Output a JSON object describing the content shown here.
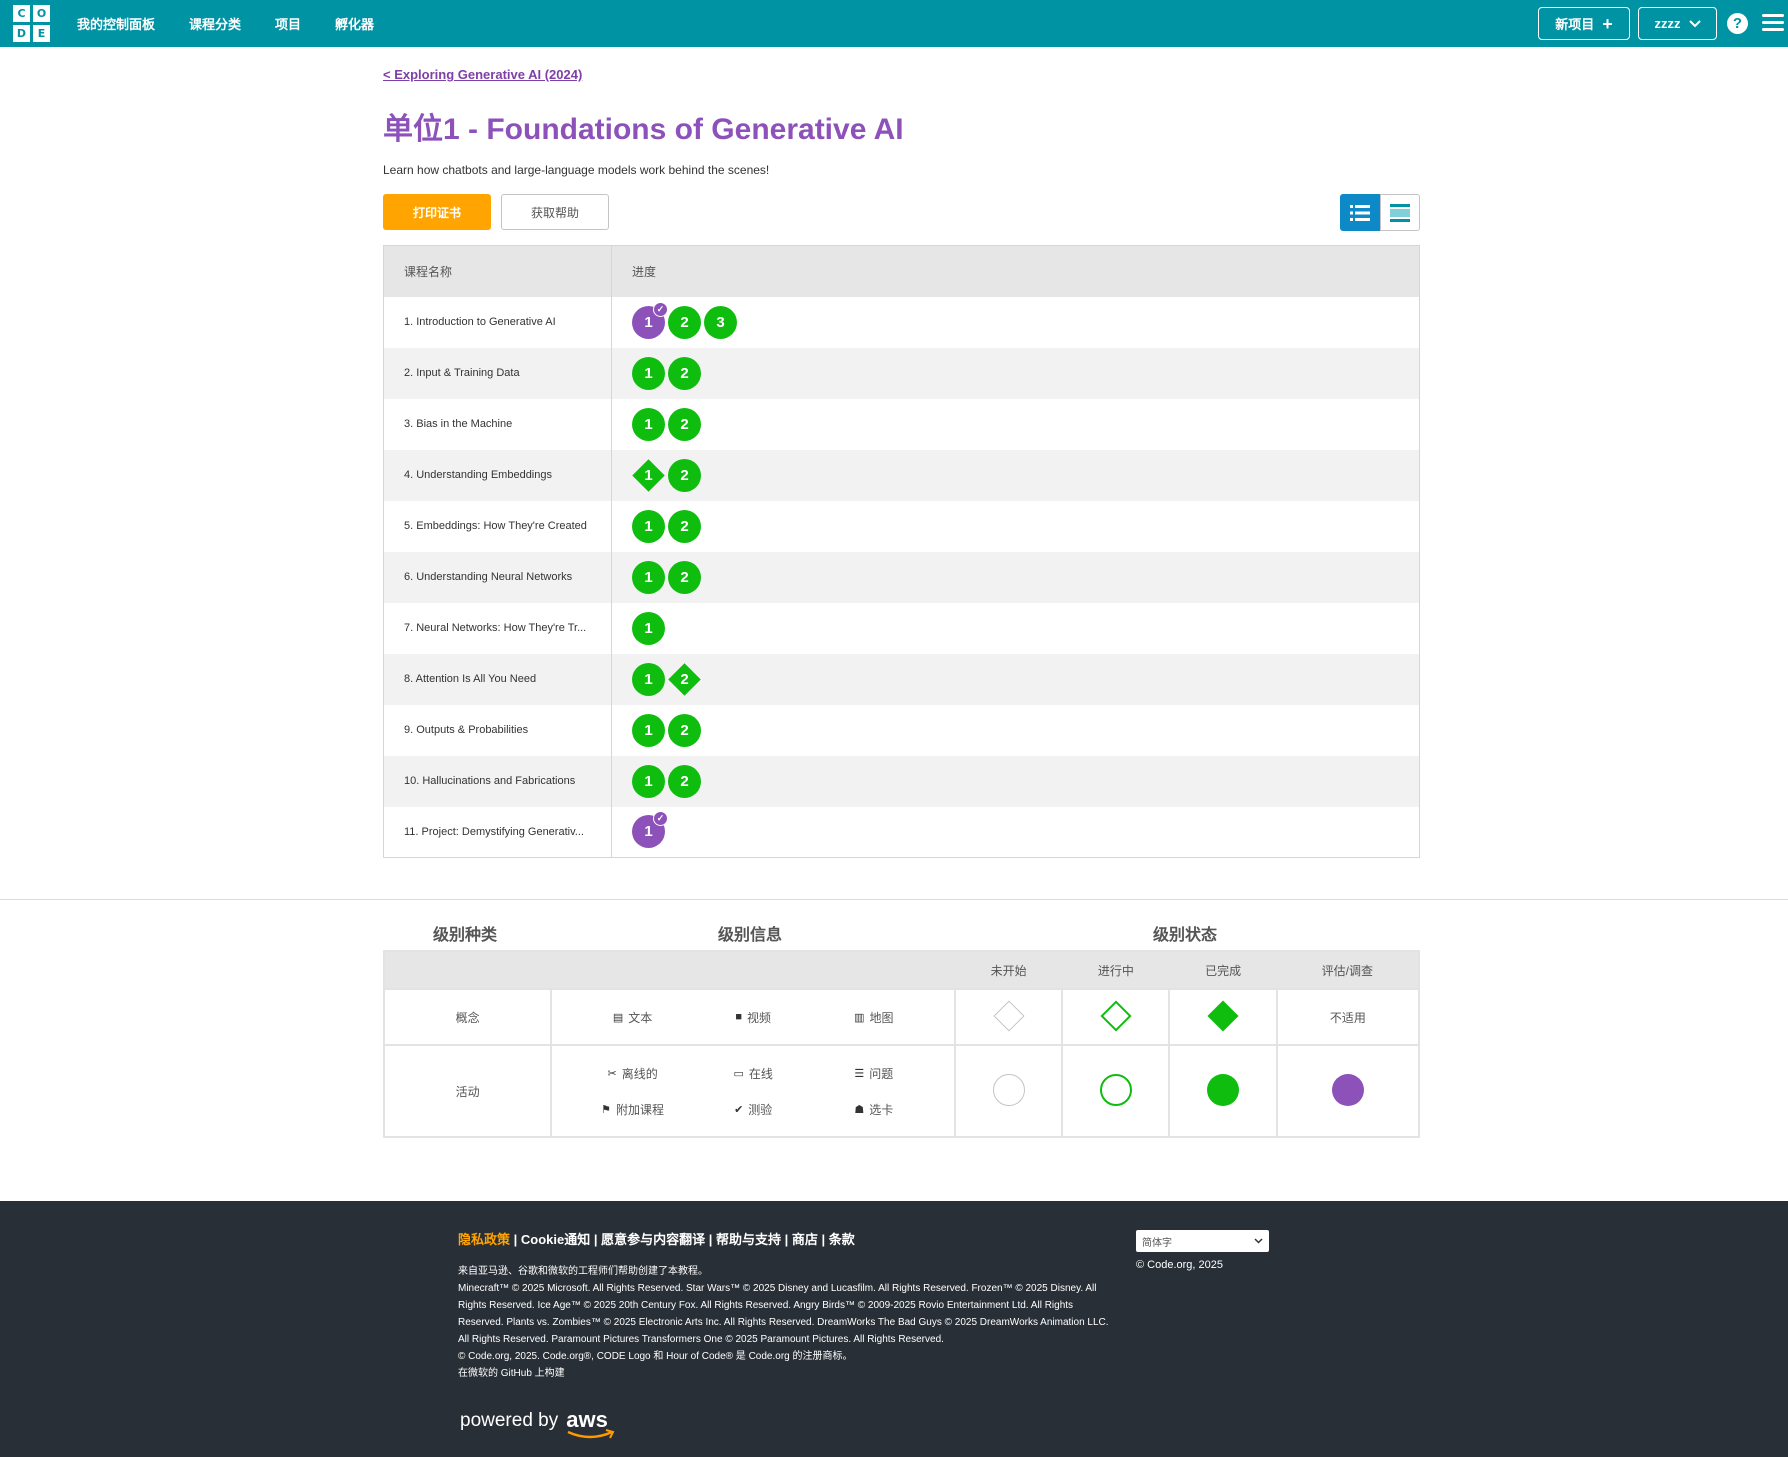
{
  "header": {
    "logo_letters": [
      "C",
      "O",
      "D",
      "E"
    ],
    "nav": [
      "我的控制面板",
      "课程分类",
      "项目",
      "孵化器"
    ],
    "new_project_label": "新项目",
    "user_label": "zzzz",
    "help_symbol": "?"
  },
  "page": {
    "back_link": "< Exploring Generative AI (2024)",
    "title": "单位1 - Foundations of Generative AI",
    "description": "Learn how chatbots and large-language models work behind the scenes!",
    "print_cert_label": "打印证书",
    "get_help_label": "获取帮助"
  },
  "progress_table": {
    "col_lesson": "课程名称",
    "col_progress": "进度",
    "rows": [
      {
        "name": "1. Introduction to Generative AI",
        "levels": [
          {
            "n": "1",
            "kind": "circle",
            "color": "purple",
            "check": true
          },
          {
            "n": "2",
            "kind": "circle",
            "color": "green"
          },
          {
            "n": "3",
            "kind": "circle",
            "color": "green"
          }
        ]
      },
      {
        "name": "2. Input & Training Data",
        "levels": [
          {
            "n": "1",
            "kind": "circle",
            "color": "green"
          },
          {
            "n": "2",
            "kind": "circle",
            "color": "green"
          }
        ]
      },
      {
        "name": "3. Bias in the Machine",
        "levels": [
          {
            "n": "1",
            "kind": "circle",
            "color": "green"
          },
          {
            "n": "2",
            "kind": "circle",
            "color": "green"
          }
        ]
      },
      {
        "name": "4. Understanding Embeddings",
        "levels": [
          {
            "n": "1",
            "kind": "diamond",
            "color": "green"
          },
          {
            "n": "2",
            "kind": "circle",
            "color": "green"
          }
        ]
      },
      {
        "name": "5. Embeddings: How They're Created",
        "levels": [
          {
            "n": "1",
            "kind": "circle",
            "color": "green"
          },
          {
            "n": "2",
            "kind": "circle",
            "color": "green"
          }
        ]
      },
      {
        "name": "6. Understanding Neural Networks",
        "levels": [
          {
            "n": "1",
            "kind": "circle",
            "color": "green"
          },
          {
            "n": "2",
            "kind": "circle",
            "color": "green"
          }
        ]
      },
      {
        "name": "7. Neural Networks: How They're Tr...",
        "levels": [
          {
            "n": "1",
            "kind": "circle",
            "color": "green"
          }
        ]
      },
      {
        "name": "8. Attention Is All You Need",
        "levels": [
          {
            "n": "1",
            "kind": "circle",
            "color": "green"
          },
          {
            "n": "2",
            "kind": "diamond",
            "color": "green"
          }
        ]
      },
      {
        "name": "9. Outputs & Probabilities",
        "levels": [
          {
            "n": "1",
            "kind": "circle",
            "color": "green"
          },
          {
            "n": "2",
            "kind": "circle",
            "color": "green"
          }
        ]
      },
      {
        "name": "10. Hallucinations and Fabrications",
        "levels": [
          {
            "n": "1",
            "kind": "circle",
            "color": "green"
          },
          {
            "n": "2",
            "kind": "circle",
            "color": "green"
          }
        ]
      },
      {
        "name": "11. Project: Demystifying Generativ...",
        "levels": [
          {
            "n": "1",
            "kind": "circle",
            "color": "purple",
            "check": true
          }
        ]
      }
    ]
  },
  "key": {
    "level_type_heading": "级别种类",
    "level_info_heading": "级别信息",
    "level_status_heading": "级别状态",
    "status_headers": [
      "未开始",
      "进行中",
      "已完成",
      "评估/调查"
    ],
    "concept_label": "概念",
    "activity_label": "活动",
    "concept_items": [
      {
        "icon": "document-icon",
        "glyph": "▤",
        "label": "文本"
      },
      {
        "icon": "video-icon",
        "glyph": "■",
        "label": "视频"
      },
      {
        "icon": "map-icon",
        "glyph": "▥",
        "label": "地图"
      }
    ],
    "activity_items": [
      {
        "icon": "scissors-icon",
        "glyph": "✂",
        "label": "离线的"
      },
      {
        "icon": "monitor-icon",
        "glyph": "▭",
        "label": "在线"
      },
      {
        "icon": "list-icon",
        "glyph": "☰",
        "label": "问题"
      },
      {
        "icon": "flag-icon",
        "glyph": "⚑",
        "label": "附加课程"
      },
      {
        "icon": "check-circle-icon",
        "glyph": "✔",
        "label": "测验"
      },
      {
        "icon": "sitemap-icon",
        "glyph": "☗",
        "label": "选卡"
      }
    ],
    "not_applicable": "不适用"
  },
  "footer": {
    "links": [
      "隐私政策",
      "Cookie通知",
      "愿意参与内容翻译",
      "帮助与支持",
      "商店",
      "条款"
    ],
    "credit_line": "来自亚马逊、谷歌和微软的工程师们帮助创建了本教程。",
    "legal": "Minecraft™ © 2025 Microsoft. All Rights Reserved. Star Wars™ © 2025 Disney and Lucasfilm. All Rights Reserved. Frozen™ © 2025 Disney. All Rights Reserved. Ice Age™ © 2025 20th Century Fox. All Rights Reserved. Angry Birds™ © 2009-2025 Rovio Entertainment Ltd. All Rights Reserved. Plants vs. Zombies™ © 2025 Electronic Arts Inc. All Rights Reserved. DreamWorks The Bad Guys © 2025 DreamWorks Animation LLC. All Rights Reserved. Paramount Pictures Transformers One © 2025 Paramount Pictures. All Rights Reserved.",
    "trademark": "© Code.org, 2025. Code.org®, CODE Logo 和 Hour of Code® 是 Code.org 的注册商标。",
    "github": "在微软的 GitHub 上构建",
    "language": "简体字",
    "copyright": "© Code.org, 2025",
    "powered_by": "powered by",
    "aws": "aws"
  },
  "colors": {
    "header_teal": "#0093a4",
    "title_purple": "#8c52ba",
    "complete_green": "#0fbd0f",
    "cert_orange": "#ffa400",
    "footer_bg": "#292f36"
  }
}
